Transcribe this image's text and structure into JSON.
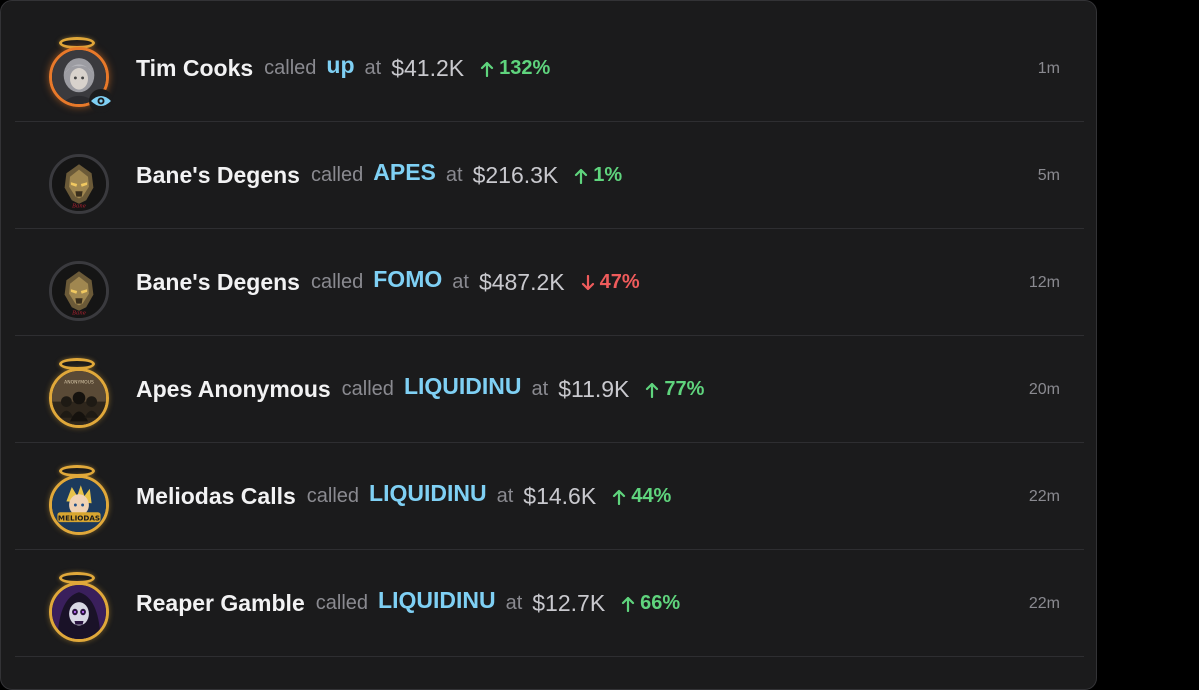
{
  "colors": {
    "panel_bg": "#1b1b1c",
    "token": "#7fd0f4",
    "positive": "#5fd47d",
    "negative": "#ef5b5b",
    "halo": "#e0a83a"
  },
  "feed": {
    "called_label": "called",
    "at_label": "at",
    "rows": [
      {
        "name": "Tim Cooks",
        "token": "up",
        "price": "$41.2K",
        "change": "132%",
        "direction": "up",
        "time": "1m",
        "avatar_icon": "grey-hair-girl-avatar",
        "ring": "orange",
        "halo": true,
        "watching": true
      },
      {
        "name": "Bane's Degens",
        "token": "APES",
        "price": "$216.3K",
        "change": "1%",
        "direction": "up",
        "time": "5m",
        "avatar_icon": "armored-mask-avatar",
        "ring": "dark",
        "halo": false,
        "watching": false
      },
      {
        "name": "Bane's Degens",
        "token": "FOMO",
        "price": "$487.2K",
        "change": "47%",
        "direction": "down",
        "time": "12m",
        "avatar_icon": "armored-mask-avatar",
        "ring": "dark",
        "halo": false,
        "watching": false
      },
      {
        "name": "Apes Anonymous",
        "token": "LIQUIDINU",
        "price": "$11.9K",
        "change": "77%",
        "direction": "up",
        "time": "20m",
        "avatar_icon": "hooded-group-avatar",
        "ring": "gold",
        "halo": true,
        "watching": false
      },
      {
        "name": "Meliodas Calls",
        "token": "LIQUIDINU",
        "price": "$14.6K",
        "change": "44%",
        "direction": "up",
        "time": "22m",
        "avatar_icon": "anime-hero-avatar",
        "ring": "gold",
        "halo": true,
        "watching": false
      },
      {
        "name": "Reaper Gamble",
        "token": "LIQUIDINU",
        "price": "$12.7K",
        "change": "66%",
        "direction": "up",
        "time": "22m",
        "avatar_icon": "skull-reaper-avatar",
        "ring": "gold",
        "halo": true,
        "watching": false
      }
    ]
  }
}
